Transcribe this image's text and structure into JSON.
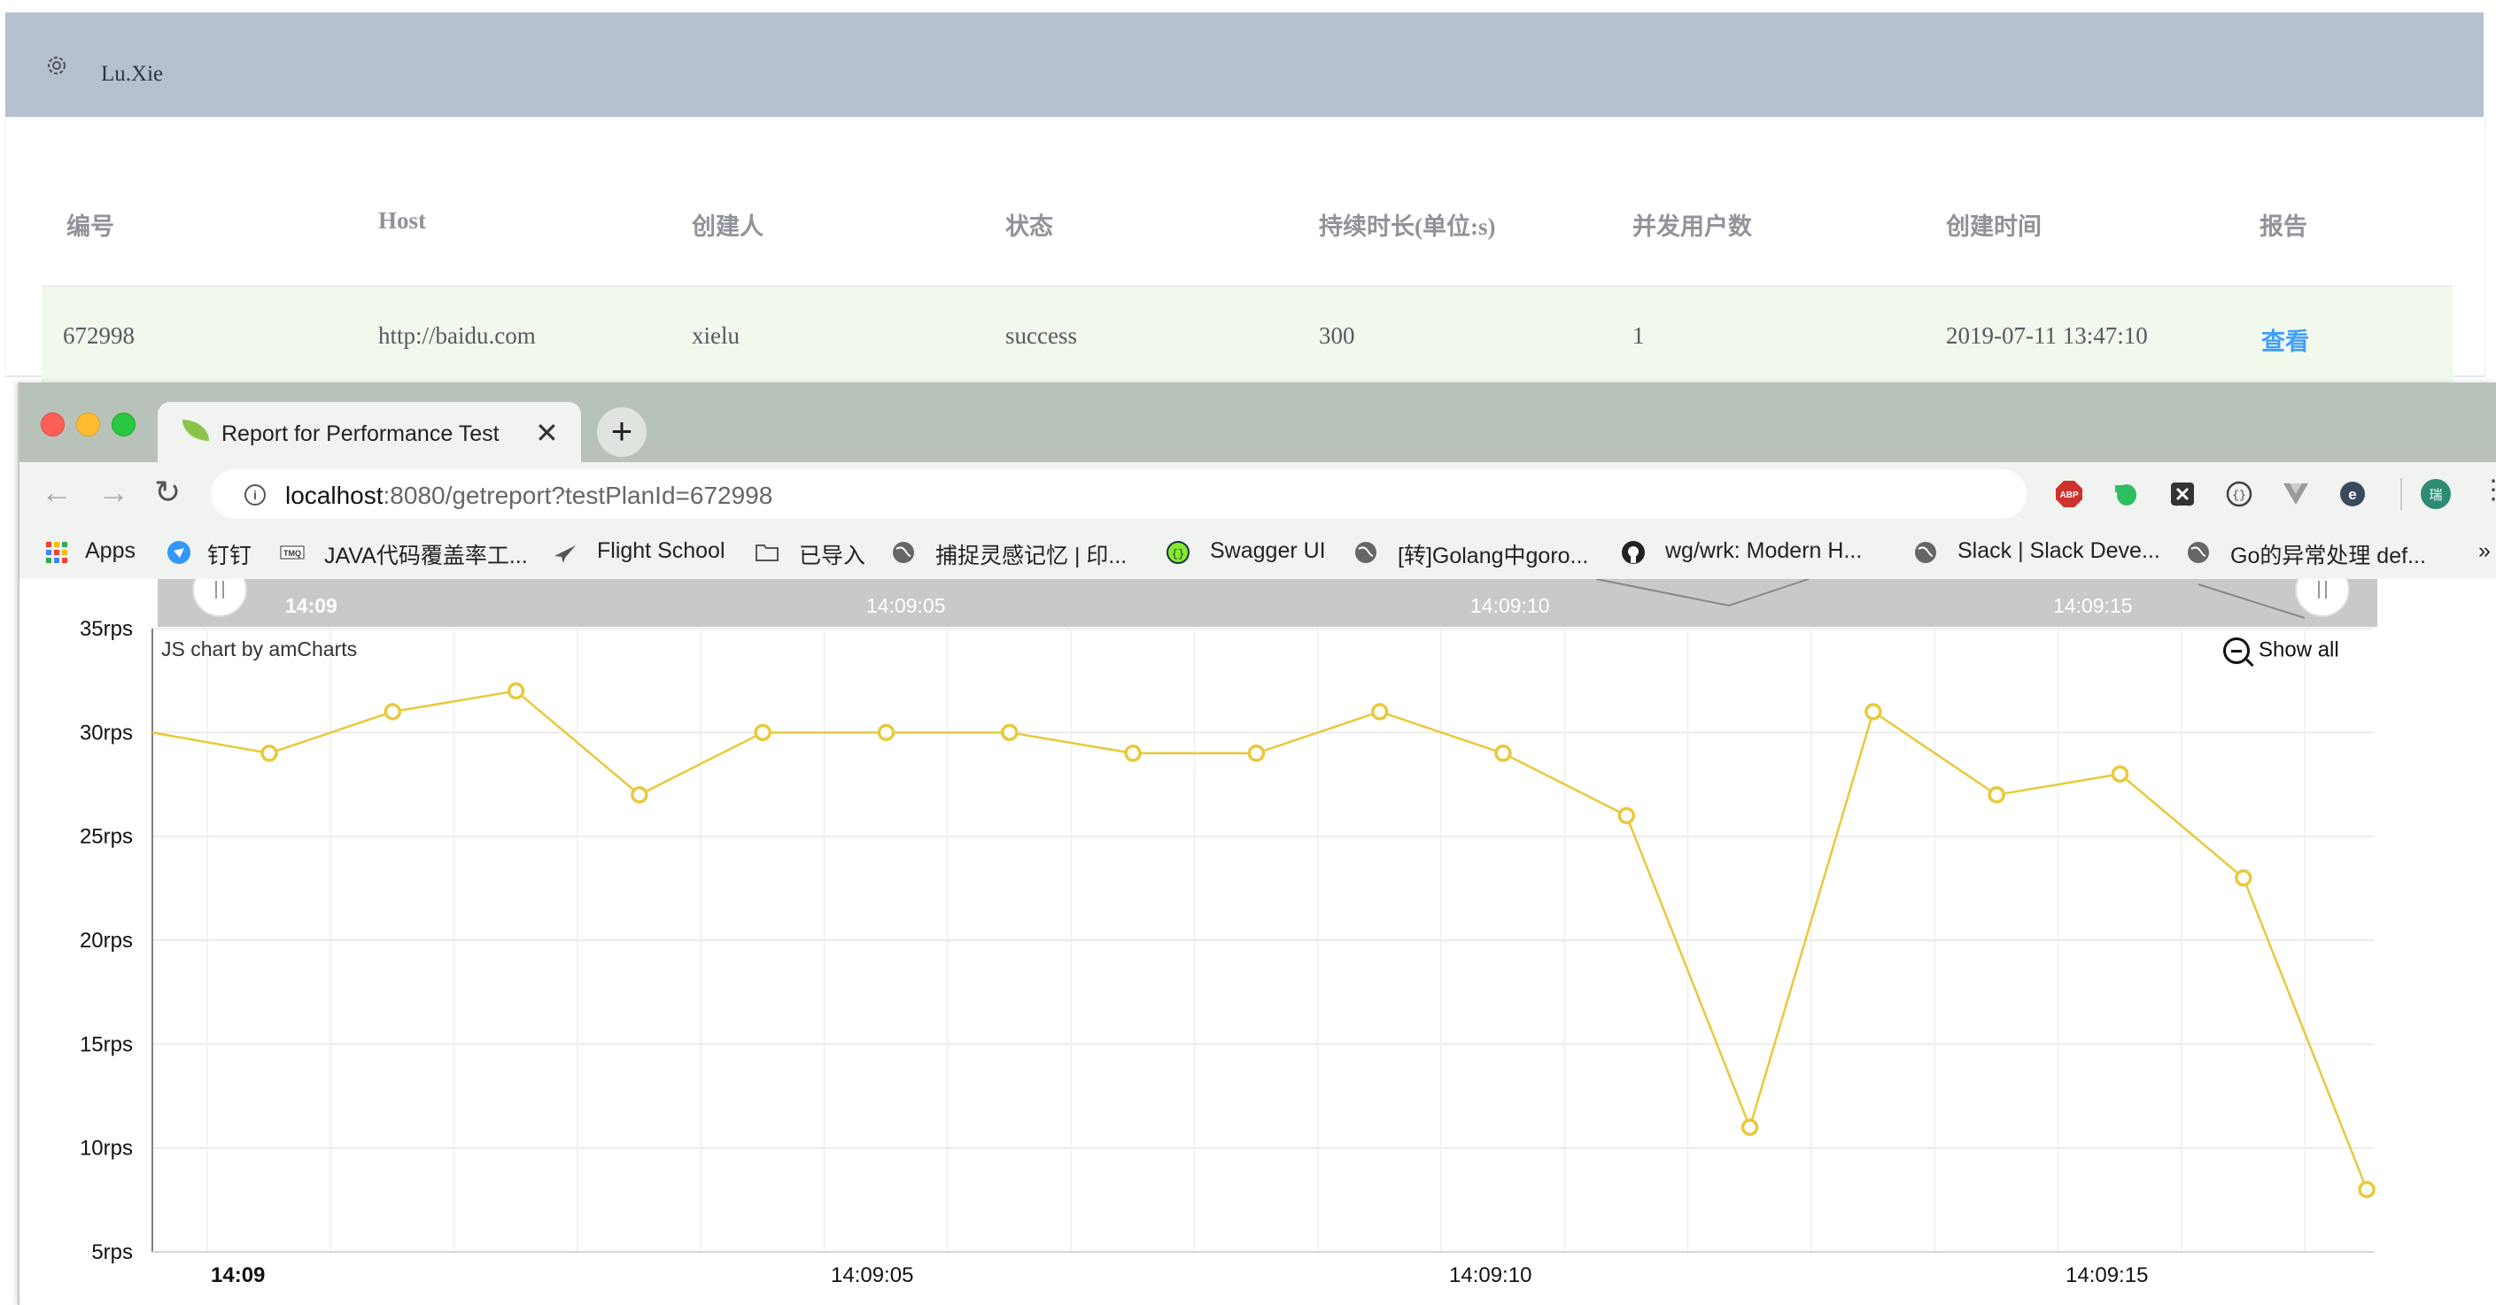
{
  "app": {
    "username": "Lu.Xie",
    "table": {
      "headers": [
        "编号",
        "Host",
        "创建人",
        "状态",
        "持续时长(单位:s)",
        "并发用户数",
        "创建时间",
        "报告"
      ],
      "rows": [
        {
          "id": "672998",
          "host": "http://baidu.com",
          "creator": "xielu",
          "status": "success",
          "duration": "300",
          "users": "1",
          "created": "2019-07-11 13:47:10",
          "report": "查看"
        }
      ]
    }
  },
  "browser": {
    "tab_title": "Report for Performance Test",
    "tab_close": "✕",
    "new_tab": "+",
    "url_host": "localhost",
    "url_rest": ":8080/getreport?testPlanId=672998",
    "extensions": {
      "abp_label": "ABP",
      "avatar_label": "瑞"
    },
    "bookmarks": [
      "Apps",
      "钉钉",
      "JAVA代码覆盖率工...",
      "Flight School",
      "已导入",
      "捕捉灵感记忆 | 印...",
      "Swagger UI",
      "[转]Golang中goro...",
      "wg/wrk: Modern H...",
      "Slack | Slack Deve...",
      "Go的异常处理 def..."
    ],
    "more": "»"
  },
  "chart_data": {
    "type": "line",
    "credit": "JS chart by amCharts",
    "show_all": "Show all",
    "x": [
      "14:09:00",
      "14:09:01",
      "14:09:02",
      "14:09:03",
      "14:09:04",
      "14:09:05",
      "14:09:06",
      "14:09:07",
      "14:09:08",
      "14:09:09",
      "14:09:10",
      "14:09:11",
      "14:09:12",
      "14:09:13",
      "14:09:14",
      "14:09:15",
      "14:09:16",
      "14:09:17",
      "14:09:18"
    ],
    "values": [
      30,
      29,
      31,
      32,
      27,
      30,
      30,
      30,
      29,
      29,
      31,
      29,
      26,
      11,
      31,
      27,
      28,
      23,
      8
    ],
    "y_ticks": [
      "35rps",
      "30rps",
      "25rps",
      "20rps",
      "15rps",
      "10rps",
      "5rps"
    ],
    "x_ticks": [
      "14:09",
      "14:09:05",
      "14:09:10",
      "14:09:15"
    ],
    "ylim": [
      5,
      35
    ],
    "line_color": "#e8c93a"
  }
}
